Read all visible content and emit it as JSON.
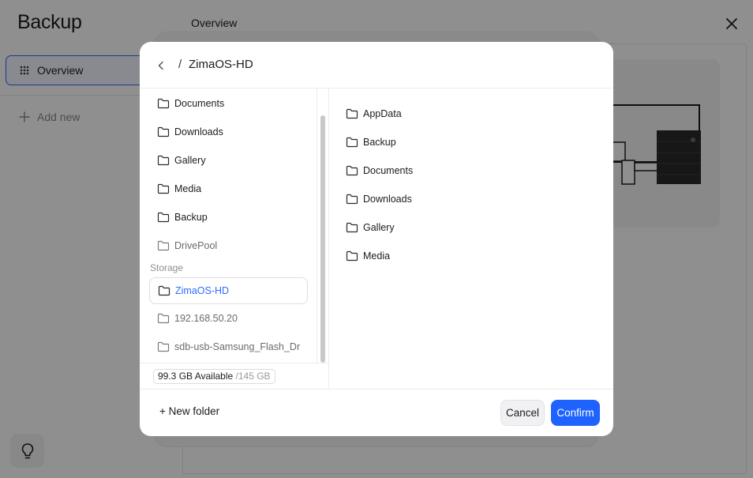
{
  "app": {
    "title": "Backup",
    "sidebar": {
      "items": [
        {
          "label": "Overview",
          "icon": "grid-dots-icon",
          "active": true
        }
      ],
      "add_new_label": "Add new"
    },
    "main": {
      "heading": "Overview"
    },
    "icons": {
      "close": "close-icon",
      "tip": "lightbulb-icon"
    },
    "accent_color": "#2b6cff"
  },
  "dialog": {
    "breadcrumb": {
      "separator": "/",
      "current": "ZimaOS-HD"
    },
    "left_tree": {
      "folders": [
        {
          "label": "Documents"
        },
        {
          "label": "Downloads"
        },
        {
          "label": "Gallery"
        },
        {
          "label": "Media"
        },
        {
          "label": "Backup"
        },
        {
          "label": "DrivePool"
        }
      ],
      "storage_section_label": "Storage",
      "storages": [
        {
          "label": "ZimaOS-HD",
          "selected": true
        },
        {
          "label": "192.168.50.20"
        },
        {
          "label": "sdb-usb-Samsung_Flash_Dr"
        }
      ],
      "storage_info": {
        "available": "99.3 GB Available",
        "total": "/145 GB"
      }
    },
    "right_list": {
      "folders": [
        {
          "label": "AppData"
        },
        {
          "label": "Backup"
        },
        {
          "label": "Documents"
        },
        {
          "label": "Downloads"
        },
        {
          "label": "Gallery"
        },
        {
          "label": "Media"
        }
      ]
    },
    "footer": {
      "new_folder_label": "+ New folder",
      "cancel_label": "Cancel",
      "confirm_label": "Confirm"
    },
    "confirm_color": "#1e63ff"
  }
}
